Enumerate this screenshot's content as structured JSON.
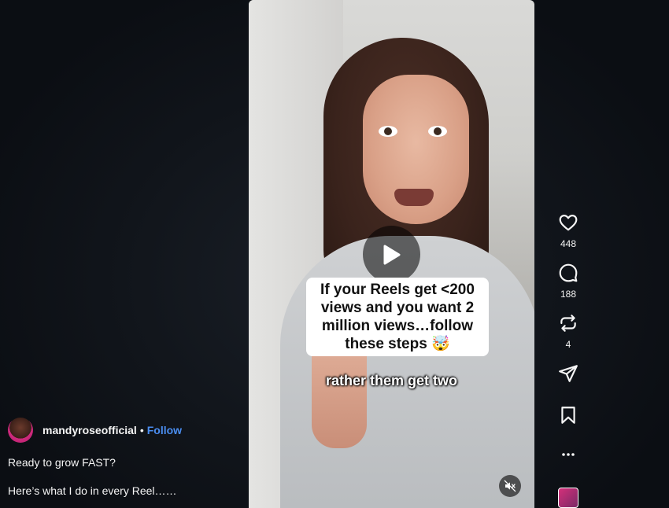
{
  "reel": {
    "caption_overlay": "If your Reels get <200 views and you want 2 million views…follow these steps 🤯",
    "subtitle": "rather them get two"
  },
  "actions": {
    "likes": "448",
    "comments": "188",
    "reposts": "4"
  },
  "author": {
    "username": "mandyroseofficial",
    "separator": "•",
    "follow_label": "Follow"
  },
  "description": {
    "line1": "Ready to grow FAST?",
    "line2": "Here’s what I do in every Reel……"
  },
  "icons": {
    "like": "heart-icon",
    "comment": "comment-icon",
    "repost": "repost-icon",
    "share": "send-icon",
    "save": "bookmark-icon",
    "more": "more-icon",
    "play": "play-icon",
    "mute": "muted-speaker-icon"
  },
  "colors": {
    "background": "#0c0f14",
    "follow": "#4a8df0",
    "text": "#f5f5f5"
  }
}
